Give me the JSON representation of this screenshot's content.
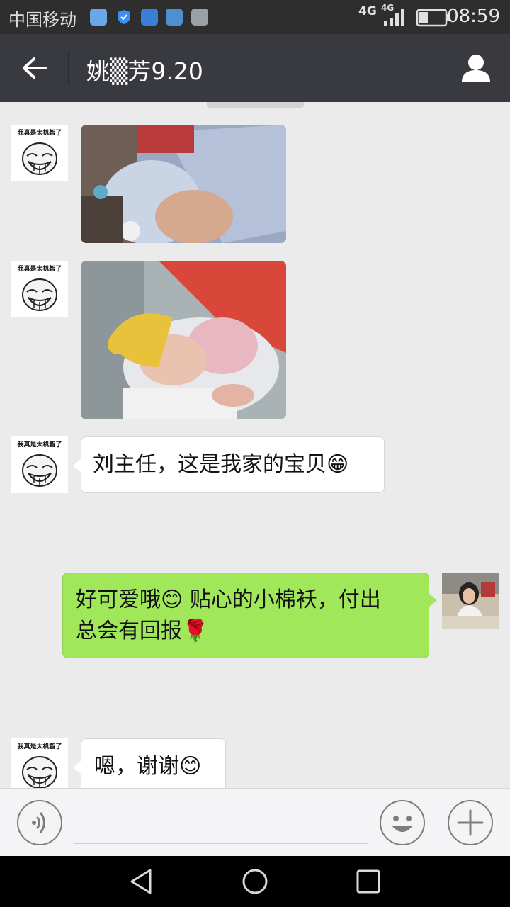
{
  "status_bar": {
    "carrier": "中国移动",
    "network_1": "4G",
    "network_2": "4G",
    "time": "08:59",
    "notification_icons": [
      "mail-app-icon",
      "shield-app-icon",
      "notes-app-icon",
      "photo-app-icon",
      "gallery-app-icon"
    ],
    "battery_level": 0.35
  },
  "header": {
    "title": "姚▒芳9.20",
    "back_icon": "arrow-left-icon",
    "profile_icon": "person-icon"
  },
  "contact": {
    "avatar_caption": "我真是太机智了"
  },
  "messages": [
    {
      "sender": "contact",
      "type": "image",
      "description_icon": "baby-photo-1"
    },
    {
      "sender": "contact",
      "type": "image",
      "description_icon": "baby-photo-2"
    },
    {
      "sender": "contact",
      "type": "text",
      "text": "刘主任，这是我家的宝贝😁"
    },
    {
      "sender": "me",
      "type": "text",
      "line1": "好可爱哦😊 贴心的小棉袄，付出",
      "line2": "总会有回报🌹"
    },
    {
      "sender": "contact",
      "type": "text",
      "text": "嗯，谢谢😊"
    }
  ],
  "input_bar": {
    "voice_icon": "voice-icon",
    "emoji_icon": "smiley-icon",
    "more_icon": "plus-icon"
  },
  "nav_bar": {
    "back_icon": "triangle-back-icon",
    "home_icon": "circle-home-icon",
    "recents_icon": "square-recents-icon"
  },
  "colors": {
    "titlebar": "#393a3f",
    "statusbar": "#2e2e2e",
    "chat_background": "#ebebeb",
    "my_bubble": "#a0e75a",
    "their_bubble": "#ffffff"
  }
}
